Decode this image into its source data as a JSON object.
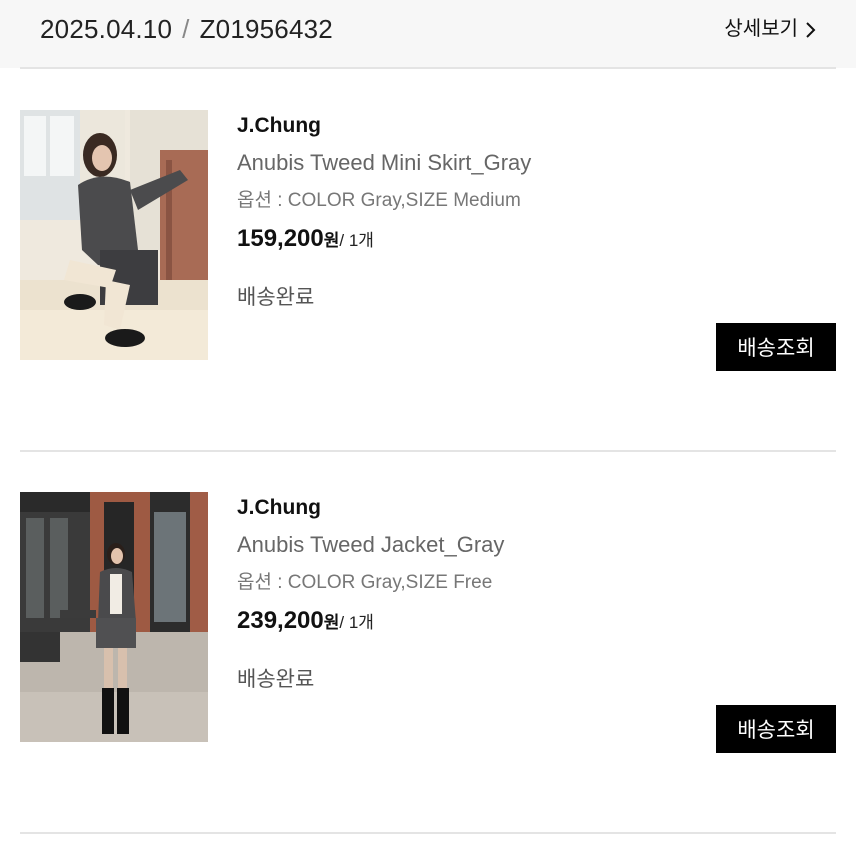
{
  "order": {
    "date": "2025.04.10",
    "separator": "/",
    "order_number": "Z01956432",
    "detail_link": "상세보기"
  },
  "items": [
    {
      "brand": "J.Chung",
      "name": "Anubis Tweed Mini Skirt_Gray",
      "option": "옵션 : COLOR Gray,SIZE Medium",
      "price": "159,200",
      "currency": "원",
      "quantity": "/ 1개",
      "status": "배송완료",
      "track_button": "배송조회"
    },
    {
      "brand": "J.Chung",
      "name": "Anubis Tweed Jacket_Gray",
      "option": "옵션 : COLOR Gray,SIZE Free",
      "price": "239,200",
      "currency": "원",
      "quantity": "/ 1개",
      "status": "배송완료",
      "track_button": "배송조회"
    }
  ]
}
